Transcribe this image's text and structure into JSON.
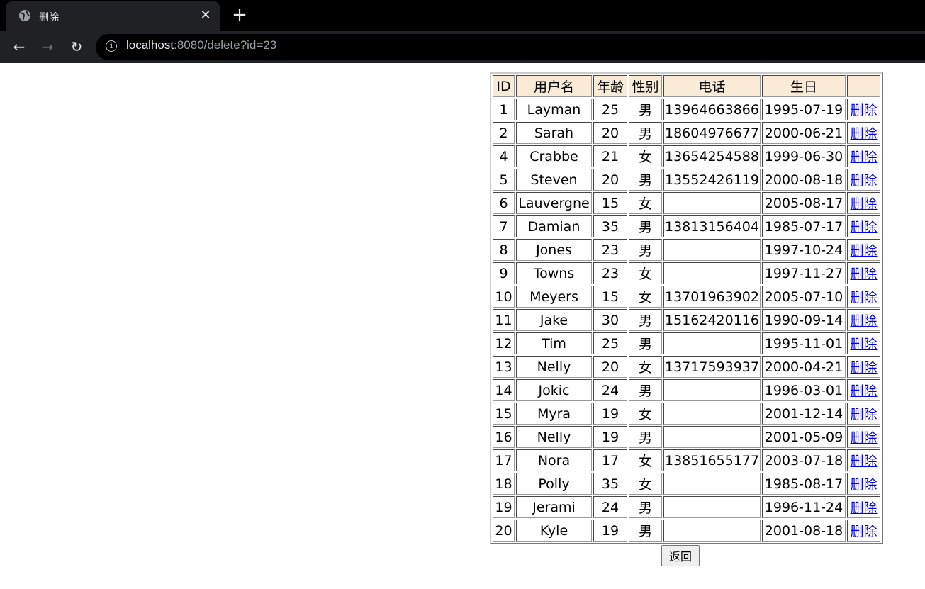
{
  "browser": {
    "tab_title": "删除",
    "tab_close": "✕",
    "new_tab": "+",
    "back": "←",
    "forward": "→",
    "reload": "↻",
    "url_host": "localhost",
    "url_rest": ":8080/delete?id=23"
  },
  "table": {
    "headers": [
      "ID",
      "用户名",
      "年龄",
      "性别",
      "电话",
      "生日",
      ""
    ],
    "delete_label": "删除",
    "rows": [
      [
        "1",
        "Layman",
        "25",
        "男",
        "13964663866",
        "1995-07-19"
      ],
      [
        "2",
        "Sarah",
        "20",
        "男",
        "18604976677",
        "2000-06-21"
      ],
      [
        "4",
        "Crabbe",
        "21",
        "女",
        "13654254588",
        "1999-06-30"
      ],
      [
        "5",
        "Steven",
        "20",
        "男",
        "13552426119",
        "2000-08-18"
      ],
      [
        "6",
        "Lauvergne",
        "15",
        "女",
        "",
        "2005-08-17"
      ],
      [
        "7",
        "Damian",
        "35",
        "男",
        "13813156404",
        "1985-07-17"
      ],
      [
        "8",
        "Jones",
        "23",
        "男",
        "",
        "1997-10-24"
      ],
      [
        "9",
        "Towns",
        "23",
        "女",
        "",
        "1997-11-27"
      ],
      [
        "10",
        "Meyers",
        "15",
        "女",
        "13701963902",
        "2005-07-10"
      ],
      [
        "11",
        "Jake",
        "30",
        "男",
        "15162420116",
        "1990-09-14"
      ],
      [
        "12",
        "Tim",
        "25",
        "男",
        "",
        "1995-11-01"
      ],
      [
        "13",
        "Nelly",
        "20",
        "女",
        "13717593937",
        "2000-04-21"
      ],
      [
        "14",
        "Jokic",
        "24",
        "男",
        "",
        "1996-03-01"
      ],
      [
        "15",
        "Myra",
        "19",
        "女",
        "",
        "2001-12-14"
      ],
      [
        "16",
        "Nelly",
        "19",
        "男",
        "",
        "2001-05-09"
      ],
      [
        "17",
        "Nora",
        "17",
        "女",
        "13851655177",
        "2003-07-18"
      ],
      [
        "18",
        "Polly",
        "35",
        "女",
        "",
        "1985-08-17"
      ],
      [
        "19",
        "Jerami",
        "24",
        "男",
        "",
        "1996-11-24"
      ],
      [
        "20",
        "Kyle",
        "19",
        "男",
        "",
        "2001-08-18"
      ]
    ]
  },
  "back_button": "返回"
}
